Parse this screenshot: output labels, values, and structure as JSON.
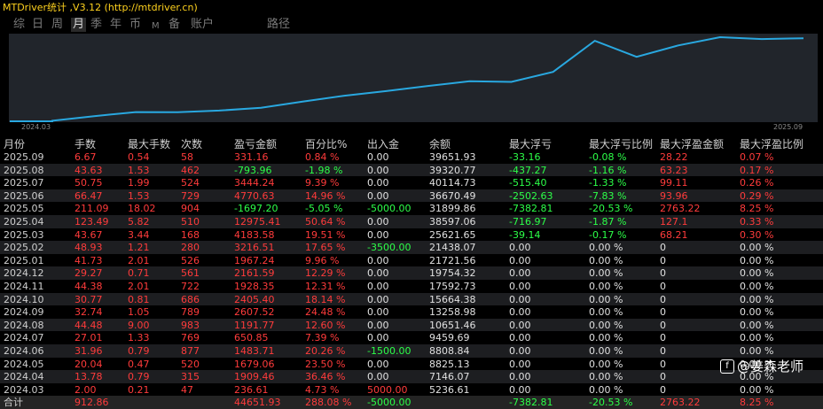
{
  "window": {
    "title": "MTDriver统计 ,V3.12 (http://mtdriver.cn)"
  },
  "tabs": [
    {
      "label": "综",
      "active": false
    },
    {
      "label": "日",
      "active": false
    },
    {
      "label": "周",
      "active": false
    },
    {
      "label": "月",
      "active": true
    },
    {
      "label": "季",
      "active": false
    },
    {
      "label": "年",
      "active": false
    },
    {
      "label": "币",
      "active": false
    },
    {
      "label": "M",
      "active": false
    },
    {
      "label": "备",
      "active": false
    },
    {
      "label": "账户",
      "active": false
    },
    {
      "label": "路径",
      "active": false
    }
  ],
  "chart_data": {
    "type": "line",
    "x_start_label": "2024.03",
    "x_end_label": "2025.09",
    "x": [
      "2024.03",
      "2024.04",
      "2024.05",
      "2024.06",
      "2024.07",
      "2024.08",
      "2024.09",
      "2024.10",
      "2024.11",
      "2024.12",
      "2025.01",
      "2025.02",
      "2025.03",
      "2025.04",
      "2025.05",
      "2025.06",
      "2025.07",
      "2025.08",
      "2025.09"
    ],
    "values": [
      5236.61,
      7146.07,
      8825.13,
      8808.84,
      9459.69,
      10651.46,
      13258.98,
      15664.38,
      17592.73,
      19754.32,
      21721.56,
      21438.07,
      25621.65,
      38597.06,
      31899.86,
      36670.49,
      40114.73,
      39320.77,
      39651.93
    ],
    "line_color": "#29a8e0"
  },
  "table": {
    "headers": [
      "月份",
      "手数",
      "最大手数",
      "次数",
      "盈亏金额",
      "百分比%",
      "出入金",
      "余额",
      "最大浮亏",
      "最大浮亏比例",
      "最大浮盈金额",
      "最大浮盈比例"
    ],
    "rows": [
      [
        "2025.09",
        "6.67",
        "0.54",
        "58",
        "331.16",
        "0.84 %",
        "0.00",
        "39651.93",
        "-33.16",
        "-0.08 %",
        "28.22",
        "0.07 %"
      ],
      [
        "2025.08",
        "43.63",
        "1.53",
        "462",
        "-793.96",
        "-1.98 %",
        "0.00",
        "39320.77",
        "-437.27",
        "-1.16 %",
        "63.23",
        "0.17 %"
      ],
      [
        "2025.07",
        "50.75",
        "1.99",
        "524",
        "3444.24",
        "9.39 %",
        "0.00",
        "40114.73",
        "-515.40",
        "-1.33 %",
        "99.11",
        "0.26 %"
      ],
      [
        "2025.06",
        "66.47",
        "1.53",
        "729",
        "4770.63",
        "14.96 %",
        "0.00",
        "36670.49",
        "-2502.63",
        "-7.83 %",
        "93.96",
        "0.29 %"
      ],
      [
        "2025.05",
        "211.09",
        "18.02",
        "904",
        "-1697.20",
        "-5.05 %",
        "-5000.00",
        "31899.86",
        "-7382.81",
        "-20.53 %",
        "2763.22",
        "8.25 %"
      ],
      [
        "2025.04",
        "123.49",
        "5.82",
        "510",
        "12975.41",
        "50.64 %",
        "0.00",
        "38597.06",
        "-716.97",
        "-1.87 %",
        "127.1",
        "0.33 %"
      ],
      [
        "2025.03",
        "43.67",
        "3.44",
        "168",
        "4183.58",
        "19.51 %",
        "0.00",
        "25621.65",
        "-39.14",
        "-0.17 %",
        "68.21",
        "0.30 %"
      ],
      [
        "2025.02",
        "48.93",
        "1.21",
        "280",
        "3216.51",
        "17.65 %",
        "-3500.00",
        "21438.07",
        "0.00",
        "0.00 %",
        "0",
        "0.00 %"
      ],
      [
        "2025.01",
        "41.73",
        "2.01",
        "526",
        "1967.24",
        "9.96 %",
        "0.00",
        "21721.56",
        "0.00",
        "0.00 %",
        "0",
        "0.00 %"
      ],
      [
        "2024.12",
        "29.27",
        "0.71",
        "561",
        "2161.59",
        "12.29 %",
        "0.00",
        "19754.32",
        "0.00",
        "0.00 %",
        "0",
        "0.00 %"
      ],
      [
        "2024.11",
        "44.38",
        "2.01",
        "722",
        "1928.35",
        "12.31 %",
        "0.00",
        "17592.73",
        "0.00",
        "0.00 %",
        "0",
        "0.00 %"
      ],
      [
        "2024.10",
        "30.77",
        "0.81",
        "686",
        "2405.40",
        "18.14 %",
        "0.00",
        "15664.38",
        "0.00",
        "0.00 %",
        "0",
        "0.00 %"
      ],
      [
        "2024.09",
        "32.74",
        "1.05",
        "789",
        "2607.52",
        "24.48 %",
        "0.00",
        "13258.98",
        "0.00",
        "0.00 %",
        "0",
        "0.00 %"
      ],
      [
        "2024.08",
        "44.48",
        "9.00",
        "983",
        "1191.77",
        "12.60 %",
        "0.00",
        "10651.46",
        "0.00",
        "0.00 %",
        "0",
        "0.00 %"
      ],
      [
        "2024.07",
        "27.01",
        "1.33",
        "769",
        "650.85",
        "7.39 %",
        "0.00",
        "9459.69",
        "0.00",
        "0.00 %",
        "0",
        "0.00 %"
      ],
      [
        "2024.06",
        "31.96",
        "0.79",
        "877",
        "1483.71",
        "20.26 %",
        "-1500.00",
        "8808.84",
        "0.00",
        "0.00 %",
        "0",
        "0.00 %"
      ],
      [
        "2024.05",
        "20.04",
        "0.47",
        "520",
        "1679.06",
        "23.50 %",
        "0.00",
        "8825.13",
        "0.00",
        "0.00 %",
        "0",
        "0.00 %"
      ],
      [
        "2024.04",
        "13.78",
        "0.79",
        "315",
        "1909.46",
        "36.46 %",
        "0.00",
        "7146.07",
        "0.00",
        "0.00 %",
        "0",
        "0.00 %"
      ],
      [
        "2024.03",
        "2.00",
        "0.21",
        "47",
        "236.61",
        "4.73 %",
        "5000.00",
        "5236.61",
        "0.00",
        "0.00 %",
        "0",
        "0.00 %"
      ]
    ],
    "total": [
      "合计",
      "912.86",
      "",
      "",
      "44651.93",
      "288.08 %",
      "-5000.00",
      "",
      "-7382.81",
      "-20.53 %",
      "2763.22",
      "8.25 %"
    ]
  },
  "colors": {
    "title": "#ffd21e",
    "header": "#cfcfcf",
    "date": "#cfcfcf",
    "red": "#ff3b3b",
    "green": "#2cff48",
    "white": "#e0e0e0",
    "chart_bg": "#21252b",
    "line": "#29a8e0"
  },
  "watermark": {
    "text": "@姜森老师",
    "icon": "chat-bubble-icon"
  }
}
